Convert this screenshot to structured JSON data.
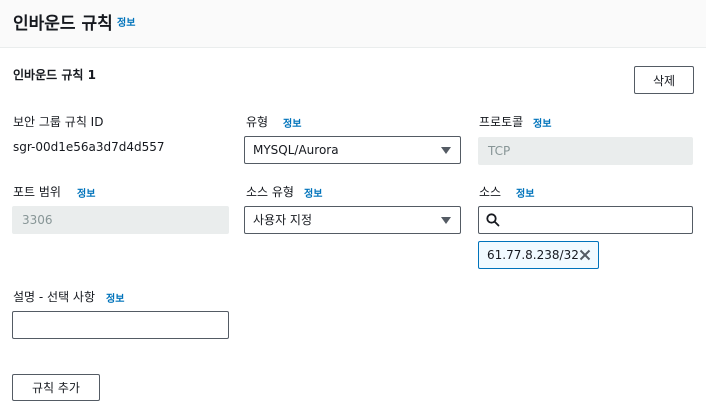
{
  "header": {
    "title": "인바운드 규칙",
    "info": "정보"
  },
  "rule": {
    "section_title": "인바운드 규칙 1",
    "delete_label": "삭제",
    "security_group_rule_id": {
      "label": "보안 그룹 규칙 ID",
      "value": "sgr-00d1e56a3d7d4d557"
    },
    "type": {
      "label": "유형",
      "info": "정보",
      "selected": "MYSQL/Aurora"
    },
    "protocol": {
      "label": "프로토콜",
      "info": "정보",
      "value": "TCP"
    },
    "port_range": {
      "label": "포트 범위",
      "info": "정보",
      "value": "3306"
    },
    "source_type": {
      "label": "소스 유형",
      "info": "정보",
      "selected": "사용자 지정"
    },
    "source": {
      "label": "소스",
      "info": "정보",
      "search_value": "",
      "token": "61.77.8.238/32"
    },
    "description": {
      "label": "설명 - 선택 사항",
      "info": "정보",
      "value": ""
    }
  },
  "add_rule_label": "규칙 추가"
}
